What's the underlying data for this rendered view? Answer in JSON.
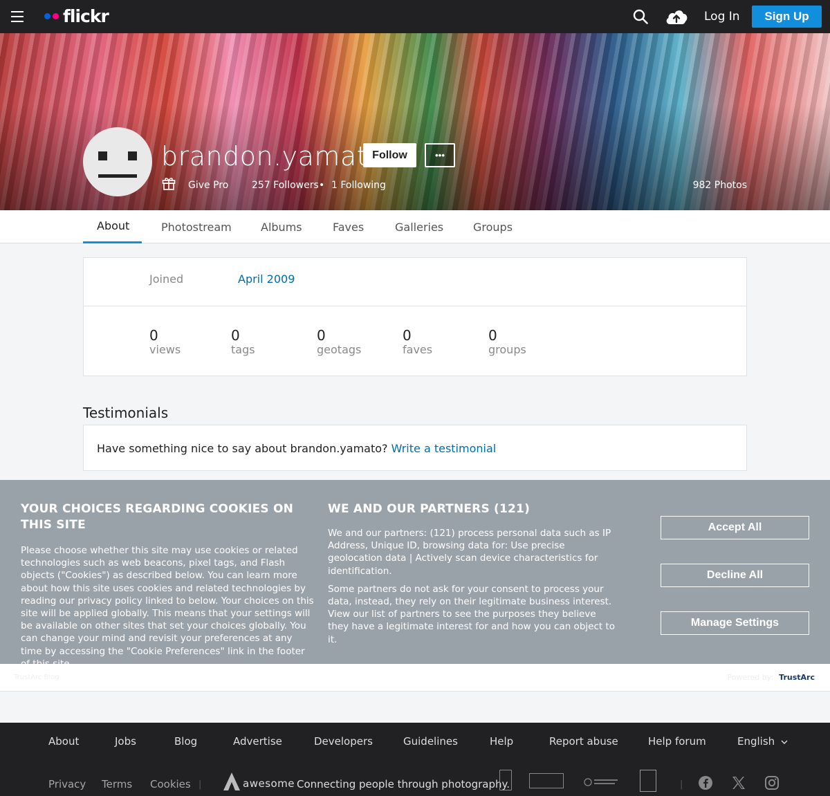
{
  "nav": {
    "logo_text": "flickr",
    "login_label": "Log In",
    "signup_label": "Sign Up",
    "colors": {
      "blue": "#0063dc",
      "pink": "#ff0084",
      "signup": "#128fdc"
    }
  },
  "profile": {
    "username": "brandon.yamato",
    "follow_label": "Follow",
    "more_label": "•••",
    "give_pro": "Give Pro",
    "followers": "257 Followers",
    "bullet": "•",
    "following": "1 Following",
    "photos": "982 Photos"
  },
  "tabs": [
    {
      "label": "About",
      "active": true
    },
    {
      "label": "Photostream"
    },
    {
      "label": "Albums"
    },
    {
      "label": "Faves"
    },
    {
      "label": "Galleries"
    },
    {
      "label": "Groups"
    }
  ],
  "about": {
    "joined_label": "Joined",
    "joined_value": "April 2009",
    "stats": [
      {
        "value": "0",
        "label": "views"
      },
      {
        "value": "0",
        "label": "tags"
      },
      {
        "value": "0",
        "label": "geotags"
      },
      {
        "value": "0",
        "label": "faves"
      },
      {
        "value": "0",
        "label": "groups"
      }
    ]
  },
  "testimonials": {
    "title": "Testimonials",
    "prompt": "Have something nice to say about brandon.yamato?",
    "link": "Write a testimonial"
  },
  "cookies": {
    "left_title": "YOUR CHOICES REGARDING COOKIES ON THIS SITE",
    "left_body": "Please choose whether this site may use cookies or related technologies such as web beacons, pixel tags, and Flash objects (\"Cookies\") as described below. You can learn more about how this site uses cookies and related technologies by reading our privacy policy linked to below. Your choices on this site will be applied globally. This means that your settings will be available on other sites that set your choices globally. You can change your mind and revisit your preferences at any time by accessing the \"Cookie Preferences\" link in the footer of this site.",
    "mid_title": "WE AND OUR PARTNERS (121)",
    "mid_body_1": "We and our partners: (121) process personal data such as IP Address, Unique ID, browsing data for: Use precise geolocation data | Actively scan device characteristics for identification.",
    "mid_body_2": "Some partners do not ask for your consent to process your data, instead, they rely on their legitimate business interest. View our list of partners to see the purposes they believe they have a legitimate interest for and how you can object to it.",
    "accept_label": "Accept All",
    "decline_label": "Decline All",
    "manage_label": "Manage Settings",
    "strip_left": "TrustArc Blog",
    "strip_right_pre": "Powered by:",
    "strip_right": "TrustArc"
  },
  "footer": {
    "links": [
      "About",
      "Jobs",
      "Blog",
      "Advertise",
      "Developers",
      "Guidelines",
      "Help",
      "Report abuse",
      "Help forum"
    ],
    "language": "English",
    "sub_links": [
      "Privacy",
      "Terms",
      "Cookies"
    ],
    "awesome_word": "awesome",
    "tagline": "Connecting people through photography."
  }
}
